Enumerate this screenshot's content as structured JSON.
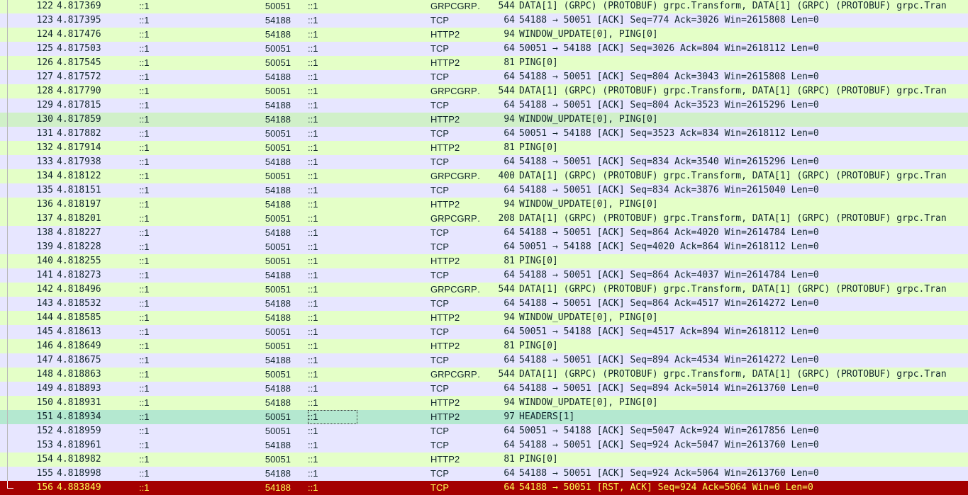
{
  "colors": {
    "tcp": "#e7e6ff",
    "http2": "#e4ffc7",
    "grpc": "#e4ffc7",
    "window_update_selected": "#d0f0c8",
    "headers": "#b4e8d0",
    "rst": "#a40000",
    "rst_text": "#ffff55"
  },
  "rows": [
    {
      "no": "122",
      "time": "4.817369",
      "src": "::1",
      "sport": "50051",
      "dst": "::1",
      "proto": "GRPCGRP…",
      "len": "544",
      "info": "DATA[1] (GRPC) (PROTOBUF) grpc.Transform, DATA[1] (GRPC) (PROTOBUF) grpc.Tran",
      "type": "grpc"
    },
    {
      "no": "123",
      "time": "4.817395",
      "src": "::1",
      "sport": "54188",
      "dst": "::1",
      "proto": "TCP",
      "len": "64",
      "info": "54188 → 50051 [ACK] Seq=774 Ack=3026 Win=2615808 Len=0",
      "type": "tcp"
    },
    {
      "no": "124",
      "time": "4.817476",
      "src": "::1",
      "sport": "54188",
      "dst": "::1",
      "proto": "HTTP2",
      "len": "94",
      "info": "WINDOW_UPDATE[0], PING[0]",
      "type": "http2"
    },
    {
      "no": "125",
      "time": "4.817503",
      "src": "::1",
      "sport": "50051",
      "dst": "::1",
      "proto": "TCP",
      "len": "64",
      "info": "50051 → 54188 [ACK] Seq=3026 Ack=804 Win=2618112 Len=0",
      "type": "tcp"
    },
    {
      "no": "126",
      "time": "4.817545",
      "src": "::1",
      "sport": "50051",
      "dst": "::1",
      "proto": "HTTP2",
      "len": "81",
      "info": "PING[0]",
      "type": "http2"
    },
    {
      "no": "127",
      "time": "4.817572",
      "src": "::1",
      "sport": "54188",
      "dst": "::1",
      "proto": "TCP",
      "len": "64",
      "info": "54188 → 50051 [ACK] Seq=804 Ack=3043 Win=2615808 Len=0",
      "type": "tcp"
    },
    {
      "no": "128",
      "time": "4.817790",
      "src": "::1",
      "sport": "50051",
      "dst": "::1",
      "proto": "GRPCGRP…",
      "len": "544",
      "info": "DATA[1] (GRPC) (PROTOBUF) grpc.Transform, DATA[1] (GRPC) (PROTOBUF) grpc.Tran",
      "type": "grpc"
    },
    {
      "no": "129",
      "time": "4.817815",
      "src": "::1",
      "sport": "54188",
      "dst": "::1",
      "proto": "TCP",
      "len": "64",
      "info": "54188 → 50051 [ACK] Seq=804 Ack=3523 Win=2615296 Len=0",
      "type": "tcp"
    },
    {
      "no": "130",
      "time": "4.817859",
      "src": "::1",
      "sport": "54188",
      "dst": "::1",
      "proto": "HTTP2",
      "len": "94",
      "info": "WINDOW_UPDATE[0], PING[0]",
      "type": "wu_sel"
    },
    {
      "no": "131",
      "time": "4.817882",
      "src": "::1",
      "sport": "50051",
      "dst": "::1",
      "proto": "TCP",
      "len": "64",
      "info": "50051 → 54188 [ACK] Seq=3523 Ack=834 Win=2618112 Len=0",
      "type": "tcp"
    },
    {
      "no": "132",
      "time": "4.817914",
      "src": "::1",
      "sport": "50051",
      "dst": "::1",
      "proto": "HTTP2",
      "len": "81",
      "info": "PING[0]",
      "type": "http2"
    },
    {
      "no": "133",
      "time": "4.817938",
      "src": "::1",
      "sport": "54188",
      "dst": "::1",
      "proto": "TCP",
      "len": "64",
      "info": "54188 → 50051 [ACK] Seq=834 Ack=3540 Win=2615296 Len=0",
      "type": "tcp"
    },
    {
      "no": "134",
      "time": "4.818122",
      "src": "::1",
      "sport": "50051",
      "dst": "::1",
      "proto": "GRPCGRP…",
      "len": "400",
      "info": "DATA[1] (GRPC) (PROTOBUF) grpc.Transform, DATA[1] (GRPC) (PROTOBUF) grpc.Tran",
      "type": "grpc"
    },
    {
      "no": "135",
      "time": "4.818151",
      "src": "::1",
      "sport": "54188",
      "dst": "::1",
      "proto": "TCP",
      "len": "64",
      "info": "54188 → 50051 [ACK] Seq=834 Ack=3876 Win=2615040 Len=0",
      "type": "tcp"
    },
    {
      "no": "136",
      "time": "4.818197",
      "src": "::1",
      "sport": "54188",
      "dst": "::1",
      "proto": "HTTP2",
      "len": "94",
      "info": "WINDOW_UPDATE[0], PING[0]",
      "type": "http2"
    },
    {
      "no": "137",
      "time": "4.818201",
      "src": "::1",
      "sport": "50051",
      "dst": "::1",
      "proto": "GRPCGRP…",
      "len": "208",
      "info": "DATA[1] (GRPC) (PROTOBUF) grpc.Transform, DATA[1] (GRPC) (PROTOBUF) grpc.Tran",
      "type": "grpc"
    },
    {
      "no": "138",
      "time": "4.818227",
      "src": "::1",
      "sport": "54188",
      "dst": "::1",
      "proto": "TCP",
      "len": "64",
      "info": "54188 → 50051 [ACK] Seq=864 Ack=4020 Win=2614784 Len=0",
      "type": "tcp"
    },
    {
      "no": "139",
      "time": "4.818228",
      "src": "::1",
      "sport": "50051",
      "dst": "::1",
      "proto": "TCP",
      "len": "64",
      "info": "50051 → 54188 [ACK] Seq=4020 Ack=864 Win=2618112 Len=0",
      "type": "tcp"
    },
    {
      "no": "140",
      "time": "4.818255",
      "src": "::1",
      "sport": "50051",
      "dst": "::1",
      "proto": "HTTP2",
      "len": "81",
      "info": "PING[0]",
      "type": "http2"
    },
    {
      "no": "141",
      "time": "4.818273",
      "src": "::1",
      "sport": "54188",
      "dst": "::1",
      "proto": "TCP",
      "len": "64",
      "info": "54188 → 50051 [ACK] Seq=864 Ack=4037 Win=2614784 Len=0",
      "type": "tcp"
    },
    {
      "no": "142",
      "time": "4.818496",
      "src": "::1",
      "sport": "50051",
      "dst": "::1",
      "proto": "GRPCGRP…",
      "len": "544",
      "info": "DATA[1] (GRPC) (PROTOBUF) grpc.Transform, DATA[1] (GRPC) (PROTOBUF) grpc.Tran",
      "type": "grpc"
    },
    {
      "no": "143",
      "time": "4.818532",
      "src": "::1",
      "sport": "54188",
      "dst": "::1",
      "proto": "TCP",
      "len": "64",
      "info": "54188 → 50051 [ACK] Seq=864 Ack=4517 Win=2614272 Len=0",
      "type": "tcp"
    },
    {
      "no": "144",
      "time": "4.818585",
      "src": "::1",
      "sport": "54188",
      "dst": "::1",
      "proto": "HTTP2",
      "len": "94",
      "info": "WINDOW_UPDATE[0], PING[0]",
      "type": "http2"
    },
    {
      "no": "145",
      "time": "4.818613",
      "src": "::1",
      "sport": "50051",
      "dst": "::1",
      "proto": "TCP",
      "len": "64",
      "info": "50051 → 54188 [ACK] Seq=4517 Ack=894 Win=2618112 Len=0",
      "type": "tcp"
    },
    {
      "no": "146",
      "time": "4.818649",
      "src": "::1",
      "sport": "50051",
      "dst": "::1",
      "proto": "HTTP2",
      "len": "81",
      "info": "PING[0]",
      "type": "http2"
    },
    {
      "no": "147",
      "time": "4.818675",
      "src": "::1",
      "sport": "54188",
      "dst": "::1",
      "proto": "TCP",
      "len": "64",
      "info": "54188 → 50051 [ACK] Seq=894 Ack=4534 Win=2614272 Len=0",
      "type": "tcp"
    },
    {
      "no": "148",
      "time": "4.818863",
      "src": "::1",
      "sport": "50051",
      "dst": "::1",
      "proto": "GRPCGRP…",
      "len": "544",
      "info": "DATA[1] (GRPC) (PROTOBUF) grpc.Transform, DATA[1] (GRPC) (PROTOBUF) grpc.Tran",
      "type": "grpc"
    },
    {
      "no": "149",
      "time": "4.818893",
      "src": "::1",
      "sport": "54188",
      "dst": "::1",
      "proto": "TCP",
      "len": "64",
      "info": "54188 → 50051 [ACK] Seq=894 Ack=5014 Win=2613760 Len=0",
      "type": "tcp"
    },
    {
      "no": "150",
      "time": "4.818931",
      "src": "::1",
      "sport": "54188",
      "dst": "::1",
      "proto": "HTTP2",
      "len": "94",
      "info": "WINDOW_UPDATE[0], PING[0]",
      "type": "http2"
    },
    {
      "no": "151",
      "time": "4.818934",
      "src": "::1",
      "sport": "50051",
      "dst": "::1",
      "proto": "HTTP2",
      "len": "97",
      "info": "HEADERS[1]",
      "type": "headers"
    },
    {
      "no": "152",
      "time": "4.818959",
      "src": "::1",
      "sport": "50051",
      "dst": "::1",
      "proto": "TCP",
      "len": "64",
      "info": "50051 → 54188 [ACK] Seq=5047 Ack=924 Win=2617856 Len=0",
      "type": "tcp"
    },
    {
      "no": "153",
      "time": "4.818961",
      "src": "::1",
      "sport": "54188",
      "dst": "::1",
      "proto": "TCP",
      "len": "64",
      "info": "54188 → 50051 [ACK] Seq=924 Ack=5047 Win=2613760 Len=0",
      "type": "tcp"
    },
    {
      "no": "154",
      "time": "4.818982",
      "src": "::1",
      "sport": "50051",
      "dst": "::1",
      "proto": "HTTP2",
      "len": "81",
      "info": "PING[0]",
      "type": "http2"
    },
    {
      "no": "155",
      "time": "4.818998",
      "src": "::1",
      "sport": "54188",
      "dst": "::1",
      "proto": "TCP",
      "len": "64",
      "info": "54188 → 50051 [ACK] Seq=924 Ack=5064 Win=2613760 Len=0",
      "type": "tcp"
    },
    {
      "no": "156",
      "time": "4.883849",
      "src": "::1",
      "sport": "54188",
      "dst": "::1",
      "proto": "TCP",
      "len": "64",
      "info": "54188 → 50051 [RST, ACK] Seq=924 Ack=5064 Win=0 Len=0",
      "type": "rst"
    }
  ]
}
